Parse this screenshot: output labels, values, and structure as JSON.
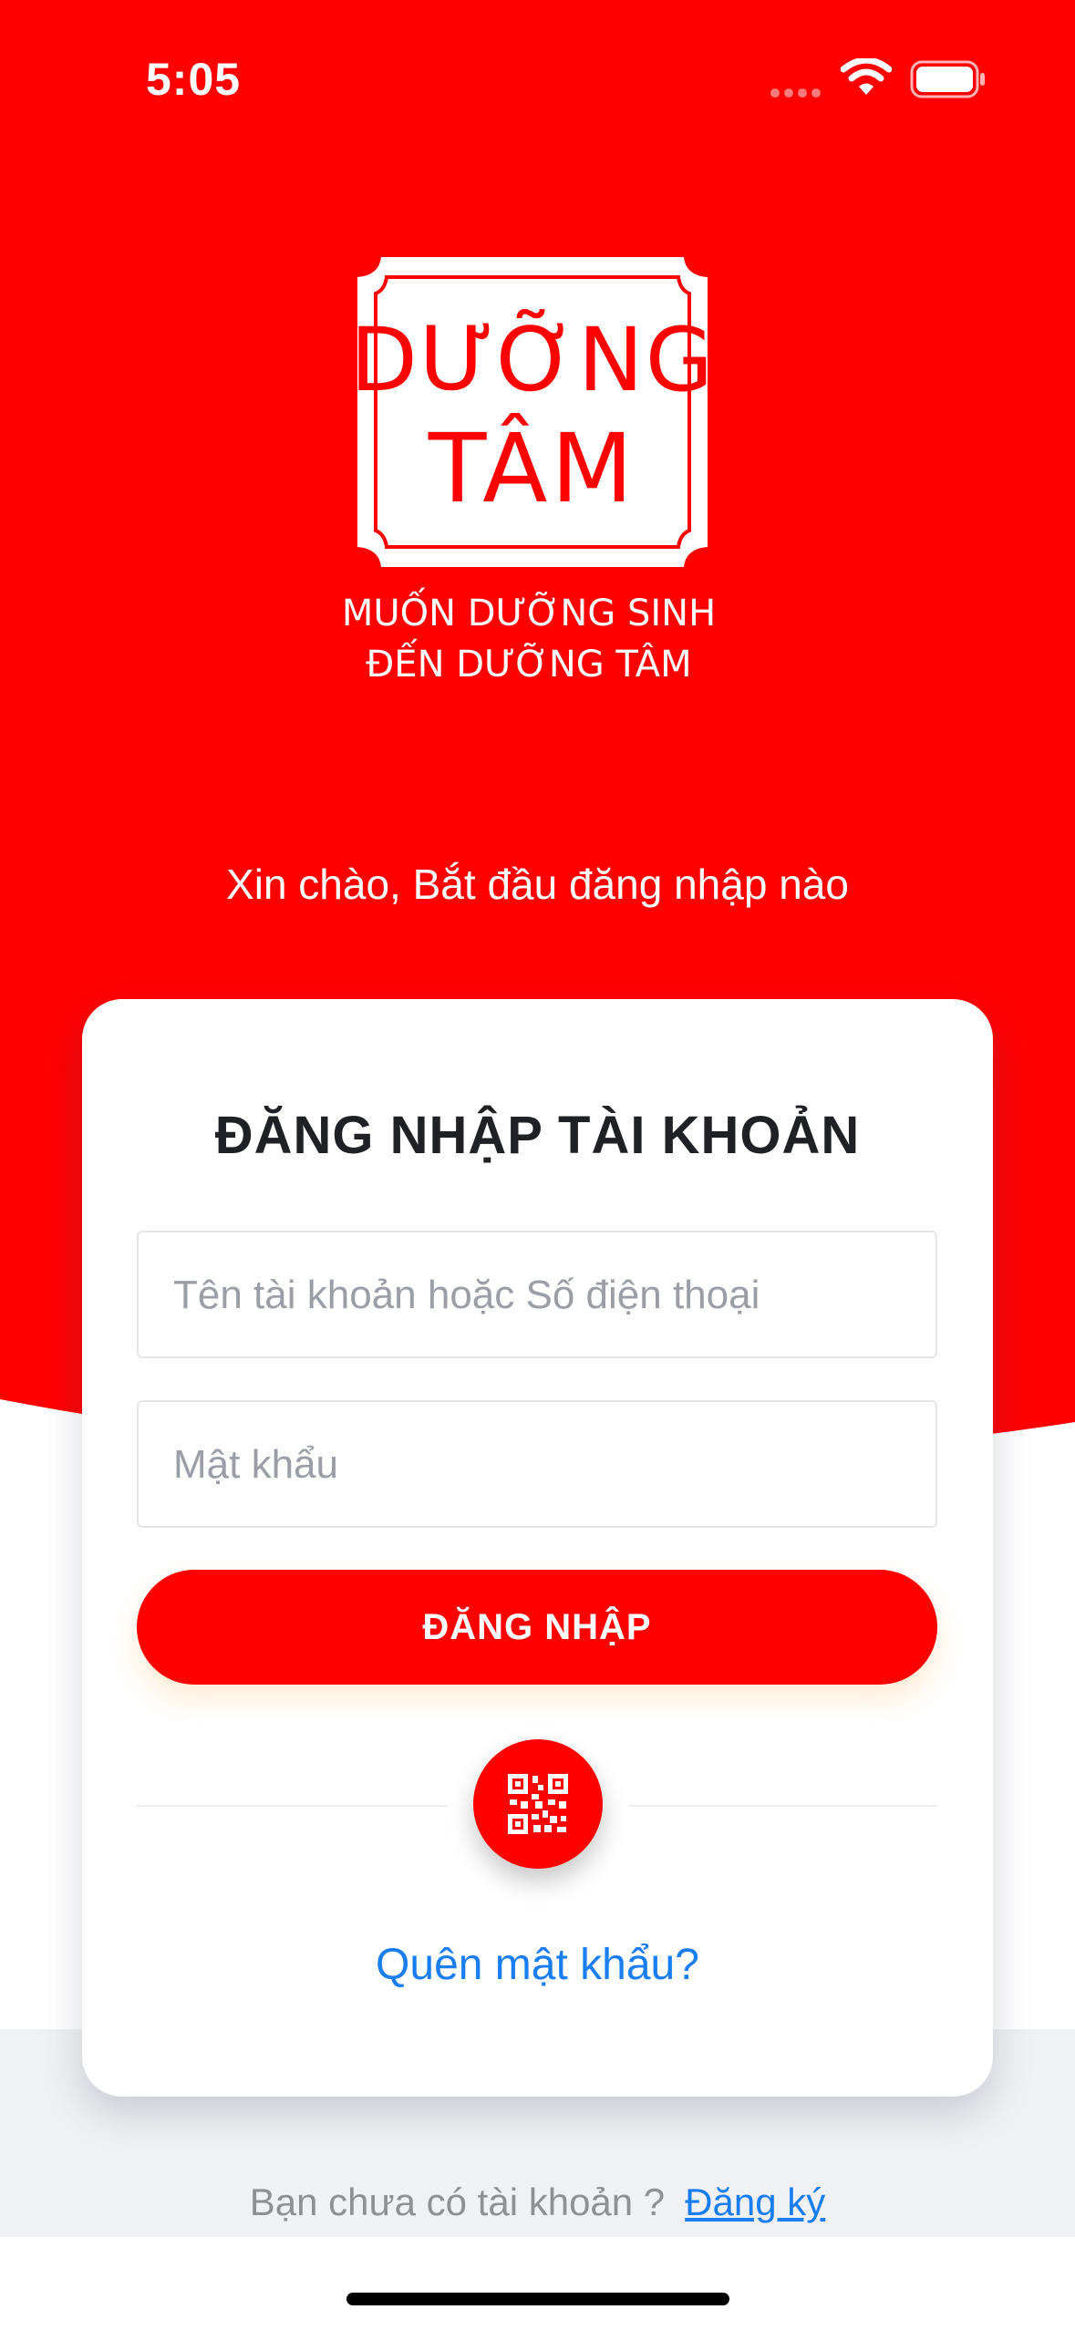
{
  "status_bar": {
    "time": "5:05"
  },
  "brand": {
    "logo_text_line1": "DƯỠNG",
    "logo_text_line2": "TÂM",
    "tagline_line1": "MUỐN DƯỠNG SINH",
    "tagline_line2": "ĐẾN DƯỠNG TÂM"
  },
  "greeting": "Xin chào, Bắt đầu đăng nhập nào",
  "login": {
    "title": "ĐĂNG NHẬP TÀI KHOẢN",
    "username_placeholder": "Tên tài khoản hoặc Số điện thoại",
    "password_placeholder": "Mật khẩu",
    "submit_label": "ĐĂNG NHẬP",
    "forgot_label": "Quên mật khẩu?"
  },
  "register": {
    "prompt": "Bạn chưa có tài khoản ?",
    "link_label": "Đăng ký"
  },
  "colors": {
    "brand_red": "#fe0000",
    "link_blue": "#1a7ef0",
    "footer_grey": "#eff1f4"
  },
  "icons": {
    "qr": "qr-code-icon",
    "wifi": "wifi-icon",
    "battery": "battery-icon",
    "signal": "signal-icon"
  }
}
